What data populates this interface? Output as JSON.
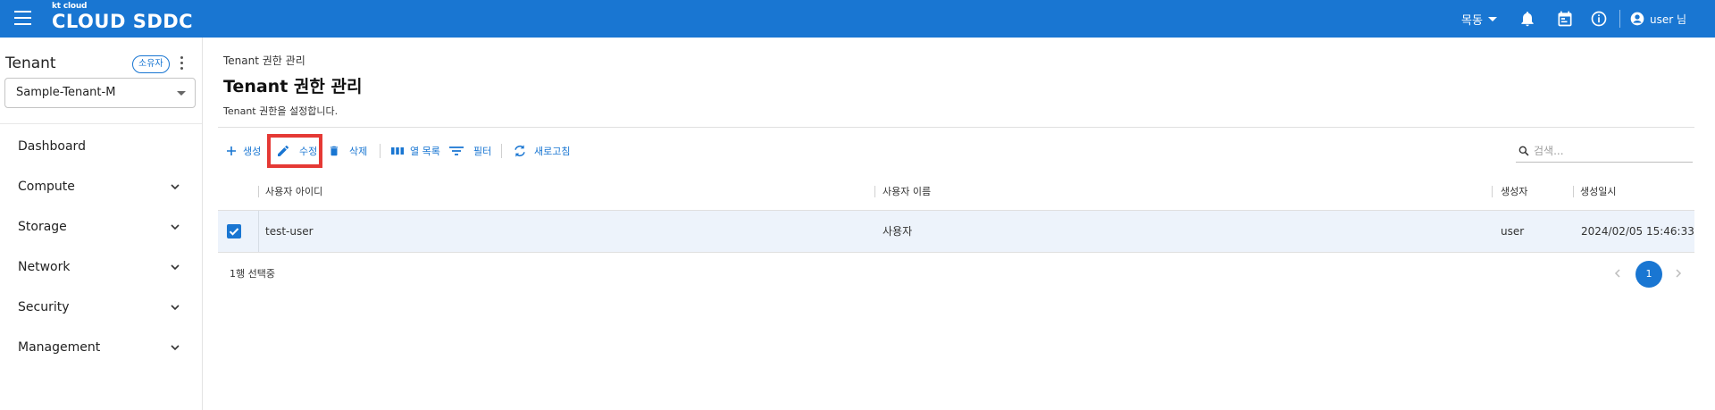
{
  "header": {
    "logo_small": "kt cloud",
    "logo_big": "CLOUD SDDC",
    "region_label": "목동",
    "user_label": "user 님",
    "icons": [
      "menu-icon",
      "bell-icon",
      "calendar-icon",
      "info-icon",
      "account-icon"
    ]
  },
  "sidebar": {
    "tenant_label": "Tenant",
    "owner_badge": "소유자",
    "tenant_selected": "Sample-Tenant-M",
    "items": [
      {
        "label": "Dashboard",
        "expandable": false
      },
      {
        "label": "Compute",
        "expandable": true
      },
      {
        "label": "Storage",
        "expandable": true
      },
      {
        "label": "Network",
        "expandable": true
      },
      {
        "label": "Security",
        "expandable": true
      },
      {
        "label": "Management",
        "expandable": true
      }
    ]
  },
  "page": {
    "breadcrumb": "Tenant 권한 관리",
    "title": "Tenant 권한 관리",
    "description": "Tenant 권한을 설정합니다."
  },
  "toolbar": {
    "create": "생성",
    "edit": "수정",
    "delete": "삭제",
    "columns": "열 목록",
    "filter": "필터",
    "refresh": "새로고침",
    "search_placeholder": "검색..."
  },
  "table": {
    "columns": [
      "사용자 아이디",
      "사용자 이름",
      "생성자",
      "생성일시"
    ],
    "rows": [
      {
        "selected": true,
        "user_id": "test-user",
        "user_name": "사용자",
        "creator": "user",
        "created_at": "2024/02/05 15:46:33"
      }
    ]
  },
  "footer": {
    "selection_count": "1행 선택중",
    "current_page": "1"
  },
  "colors": {
    "primary": "#1976d2",
    "highlight": "#e53935",
    "row_selected": "#edf3fb"
  }
}
